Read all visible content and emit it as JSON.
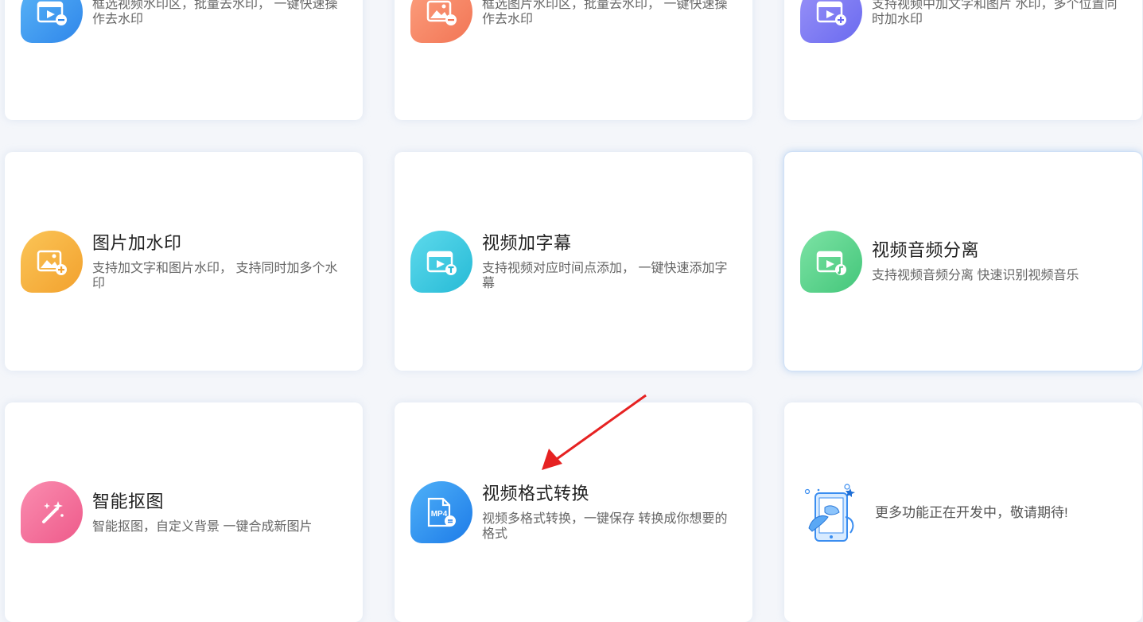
{
  "cards": [
    {
      "title": "",
      "desc": "框选视频水印区，批量去水印， 一键快速操作去水印",
      "icon": "video-remove-icon",
      "color": "#3d9bf0"
    },
    {
      "title": "",
      "desc": "框选图片水印区，批量去水印， 一键快速操作去水印",
      "icon": "image-remove-icon",
      "color": "#f78a68"
    },
    {
      "title": "",
      "desc": "支持视频中加文字和图片 水印，多个位置同时加水印",
      "icon": "video-add-icon",
      "color": "#7c7cf3"
    },
    {
      "title": "图片加水印",
      "desc": "支持加文字和图片水印， 支持同时加多个水印",
      "icon": "image-add-icon",
      "color": "#f6b340"
    },
    {
      "title": "视频加字幕",
      "desc": "支持视频对应时间点添加， 一键快速添加字幕",
      "icon": "video-subtitle-icon",
      "color": "#3fcbe3"
    },
    {
      "title": "视频音频分离",
      "desc": "支持视频音频分离 快速识别视频音乐",
      "icon": "video-audio-icon",
      "color": "#5fd58f"
    },
    {
      "title": "智能抠图",
      "desc": "智能抠图，自定义背景 一键合成新图片",
      "icon": "magic-wand-icon",
      "color": "#f36a97"
    },
    {
      "title": "视频格式转换",
      "desc": "视频多格式转换，一键保存 转换成你想要的格式",
      "icon": "mp4-convert-icon",
      "color": "#2e8df0",
      "icon_text": "MP4"
    },
    {
      "title": "",
      "desc": "更多功能正在开发中，敬请期待!",
      "icon": "phone-developing-icon",
      "color": "#3a8df0"
    }
  ],
  "annotation": {
    "arrow_color": "#e62222"
  }
}
